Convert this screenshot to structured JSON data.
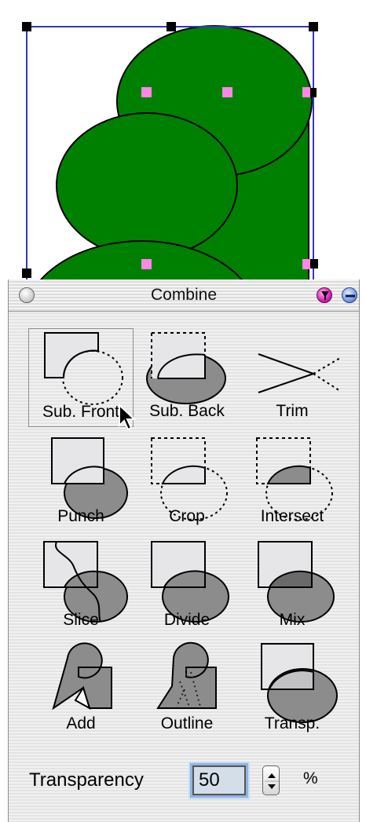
{
  "palette": {
    "title": "Combine",
    "buttons": [
      {
        "label": "Sub. Front",
        "icon": "subtract-front-icon",
        "selected": true
      },
      {
        "label": "Sub. Back",
        "icon": "subtract-back-icon"
      },
      {
        "label": "Trim",
        "icon": "trim-icon"
      },
      {
        "label": "Punch",
        "icon": "punch-icon"
      },
      {
        "label": "Crop",
        "icon": "crop-icon"
      },
      {
        "label": "Intersect",
        "icon": "intersect-icon"
      },
      {
        "label": "Slice",
        "icon": "slice-icon"
      },
      {
        "label": "Divide",
        "icon": "divide-icon"
      },
      {
        "label": "Mix",
        "icon": "mix-icon"
      },
      {
        "label": "Add",
        "icon": "add-icon"
      },
      {
        "label": "Outline",
        "icon": "outline-icon"
      },
      {
        "label": "Transp.",
        "icon": "transparency-icon"
      }
    ],
    "transparency": {
      "label": "Transparency",
      "value": "50",
      "unit": "%"
    }
  },
  "colors": {
    "shape_fill": "#008000",
    "selection_border": "#3333cc",
    "handle_black": "#000000",
    "handle_pink": "#ff88e6",
    "icon_fill_light": "#e6e6e9",
    "icon_fill_dark": "#8c8c8c"
  }
}
